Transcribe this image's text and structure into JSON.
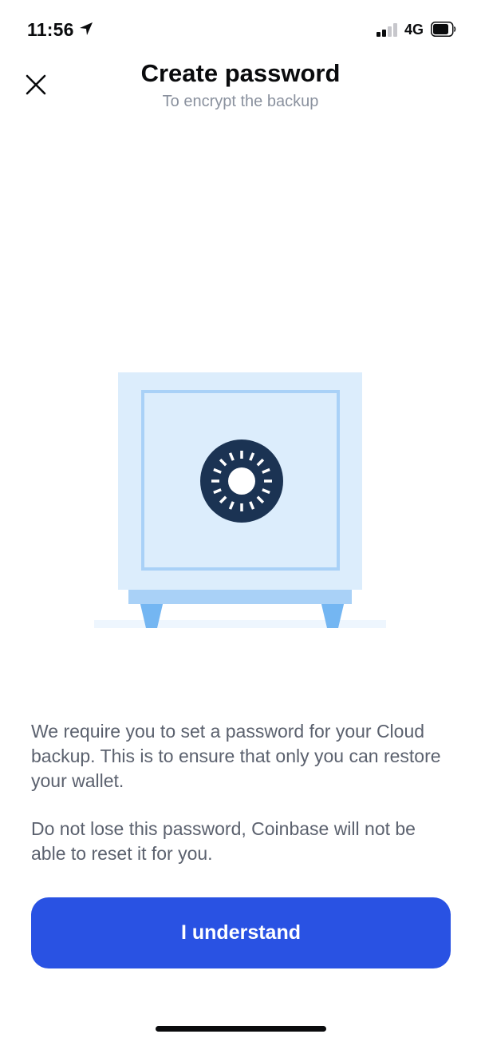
{
  "status_bar": {
    "time": "11:56",
    "network": "4G",
    "location_icon": "location-arrow-icon",
    "signal_icon": "cellular-signal-icon",
    "battery_icon": "battery-icon"
  },
  "header": {
    "close_icon": "close-icon",
    "title": "Create password",
    "subtitle": "To encrypt the backup"
  },
  "illustration": {
    "name": "safe-illustration",
    "colors": {
      "body": "#dcedfc",
      "frame": "#a9d1f7",
      "base": "#a9d1f7",
      "legs": "#74b6f2",
      "floor": "#eef6fe",
      "dial": "#1b3353"
    }
  },
  "body": {
    "paragraph_1": "We require you to set a password for your Cloud backup. This is to ensure that only you can restore your wallet.",
    "paragraph_2": "Do not lose this password, Coinbase will not be able to reset it for you."
  },
  "cta": {
    "label": "I understand",
    "color": "#2952e3"
  }
}
